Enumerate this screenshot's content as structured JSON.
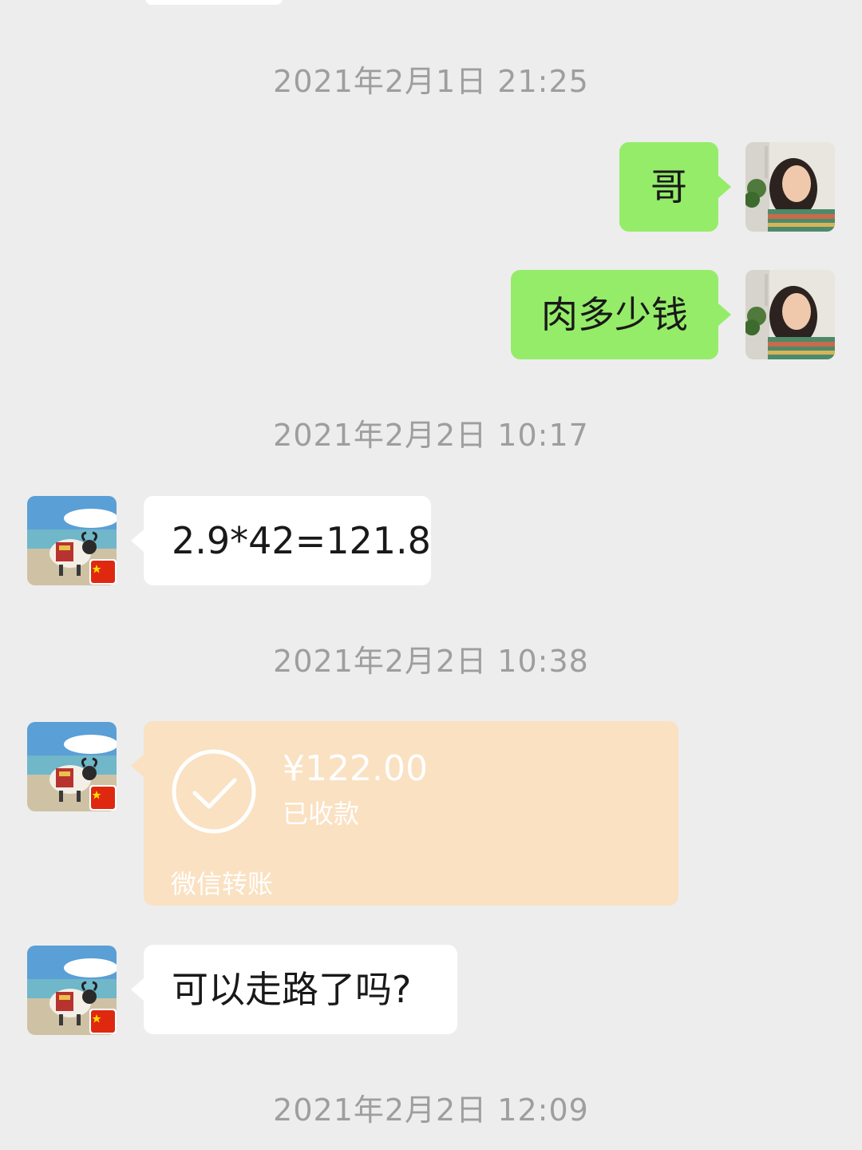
{
  "timestamps": [
    "2021年2月1日 21:25",
    "2021年2月2日 10:17",
    "2021年2月2日 10:38",
    "2021年2月2日 12:09"
  ],
  "messages": [
    {
      "side": "right",
      "text": "哥"
    },
    {
      "side": "right",
      "text": "肉多少钱"
    },
    {
      "side": "left",
      "text": "2.9*42=121.8"
    },
    {
      "side": "left",
      "text": "可以走路了吗?"
    }
  ],
  "transfer": {
    "amount": "¥122.00",
    "status": "已收款",
    "label": "微信转账"
  },
  "colors": {
    "background": "#ededed",
    "sent_bubble": "#95ec69",
    "received_bubble": "#ffffff",
    "transfer_card": "#fae1c2",
    "timestamp": "#9e9e9e"
  }
}
